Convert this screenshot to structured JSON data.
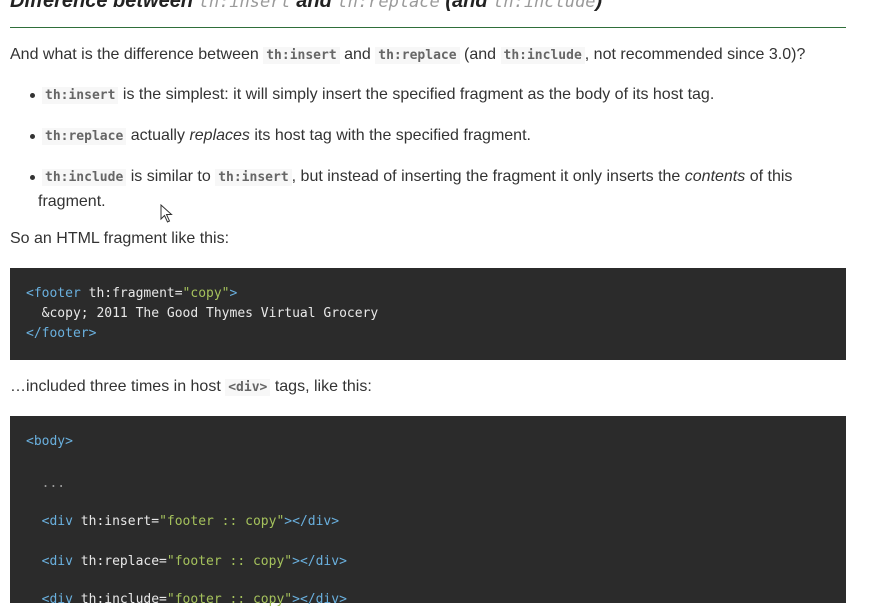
{
  "heading": {
    "prefix": "Difference between",
    "code1": "th:insert",
    "and1": "and",
    "code2": "th:replace",
    "and2": "(and",
    "code3": "th:include",
    "close": ")"
  },
  "intro": {
    "t1": "And what is the difference between",
    "c1": "th:insert",
    "t2": "and",
    "c2": "th:replace",
    "t3": "(and",
    "c3": "th:include",
    "t4": ", not recommended since 3.0)?"
  },
  "bullets": [
    {
      "code": "th:insert",
      "text": "is the simplest: it will simply insert the specified fragment as the body of its host tag."
    },
    {
      "code": "th:replace",
      "text1": "actually",
      "em": "replaces",
      "text2": "its host tag with the specified fragment."
    },
    {
      "code": "th:include",
      "text1": "is similar to",
      "code2": "th:insert",
      "text2": ", but instead of inserting the fragment it only inserts the",
      "em": "contents",
      "text3": "of this",
      "text4": "fragment."
    }
  ],
  "para2": "So an HTML fragment like this:",
  "code1": {
    "l1_open": "<",
    "l1_tag": "footer",
    "l1_attr": " th:fragment=",
    "l1_val": "\"copy\"",
    "l1_close": ">",
    "l2": "  &copy; 2011 The Good Thymes Virtual Grocery",
    "l3_open": "</",
    "l3_tag": "footer",
    "l3_close": ">"
  },
  "para3": {
    "t1": "…included three times in host",
    "c1": "<div>",
    "t2": "tags, like this:"
  },
  "code2": {
    "l1": "<body>",
    "l2": "  ...",
    "l3_open": "  <div",
    "l3_attr": " th:insert=",
    "l3_val": "\"footer :: copy\"",
    "l3_close": "></div>",
    "l4_open": "  <div",
    "l4_attr": " th:replace=",
    "l4_val": "\"footer :: copy\"",
    "l4_close": "></div>",
    "l5_open": "  <div",
    "l5_attr": " th:include=",
    "l5_val": "\"footer :: copy\"",
    "l5_close": "></div>"
  }
}
